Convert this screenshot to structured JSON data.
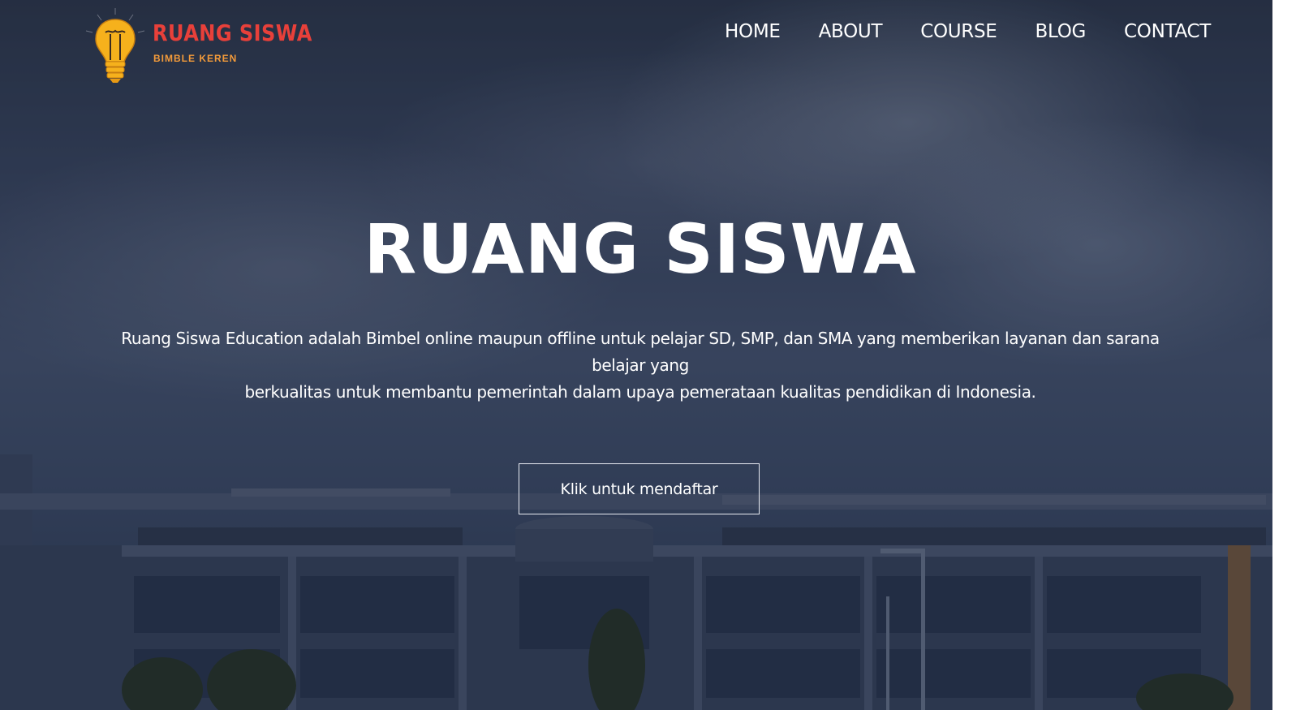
{
  "header": {
    "logo": {
      "title": "RUANG SISWA",
      "subtitle": "BIMBLE KEREN",
      "icon": "lightbulb-icon",
      "title_color": "#e8403a",
      "subtitle_color": "#f29a3a",
      "bulb_color": "#f6b11c"
    },
    "nav": {
      "home": "HOME",
      "about": "ABOUT",
      "course": "COURSE",
      "blog": "BLOG",
      "contact": "CONTACT"
    }
  },
  "hero": {
    "title": "RUANG SISWA",
    "description_line1": "Ruang Siswa Education adalah Bimbel online maupun offline untuk pelajar SD, SMP, dan SMA yang memberikan layanan dan sarana",
    "description_line2": "belajar yang",
    "description_line3": "berkualitas untuk membantu pemerintah dalam upaya pemerataan kualitas pendidikan di Indonesia.",
    "cta_label": "Klik untuk mendaftar",
    "background": "building-under-cloudy-sky-photo"
  }
}
